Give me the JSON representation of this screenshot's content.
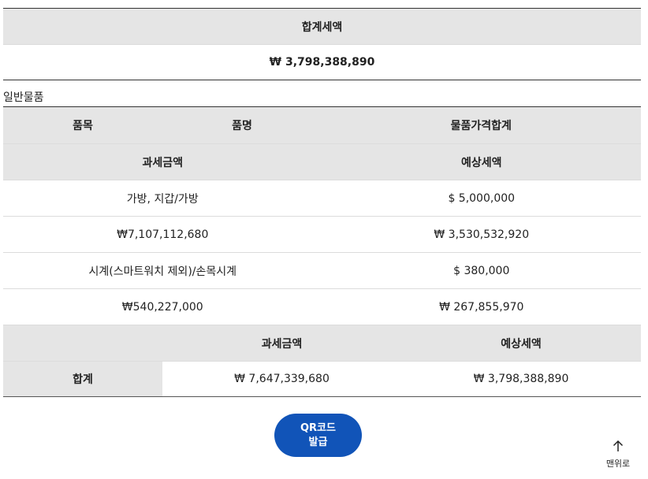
{
  "total": {
    "heading": "합계세액",
    "amount": "₩ 3,798,388,890"
  },
  "section": {
    "title": "일반물품"
  },
  "table": {
    "header_row1": {
      "category": "품목",
      "name": "품명",
      "price_total": "물품가격합계"
    },
    "header_row2": {
      "taxable": "과세금액",
      "estimated_tax": "예상세액"
    },
    "items": [
      {
        "name": "가방, 지갑/가방",
        "price": "$ 5,000,000",
        "taxable": "₩7,107,112,680",
        "tax": "₩ 3,530,532,920"
      },
      {
        "name": "시계(스마트워치 제외)/손목시계",
        "price": "$ 380,000",
        "taxable": "₩540,227,000",
        "tax": "₩ 267,855,970"
      }
    ]
  },
  "summary": {
    "col_taxable": "과세금액",
    "col_tax": "예상세액",
    "label": "합계",
    "taxable": "₩ 7,647,339,680",
    "tax": "₩ 3,798,388,890"
  },
  "buttons": {
    "qr_line1": "QR코드",
    "qr_line2": "발급",
    "to_top_icon": "arrow-up-icon",
    "to_top_label": "맨위로"
  }
}
